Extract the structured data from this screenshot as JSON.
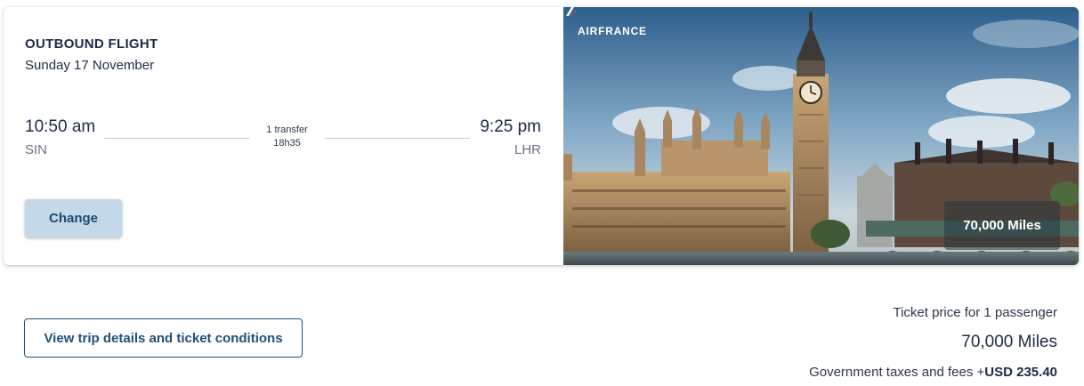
{
  "flight": {
    "title": "OUTBOUND FLIGHT",
    "date": "Sunday 17 November",
    "departure": {
      "time": "10:50 am",
      "airport": "SIN"
    },
    "arrival": {
      "time": "9:25 pm",
      "airport": "LHR"
    },
    "transfers": "1 transfer",
    "duration": "18h35",
    "change_label": "Change"
  },
  "photo": {
    "brand": "AIRFRANCE",
    "miles_badge": "70,000 Miles"
  },
  "footer": {
    "details_label": "View trip details and ticket conditions",
    "price_label": "Ticket price for 1 passenger",
    "price_value": "70,000 Miles",
    "fees_label": "Government taxes and fees +",
    "fees_value": "USD 235.40"
  },
  "colors": {
    "button_fill": "#c3d9ea",
    "accent": "#1f4f7a"
  }
}
